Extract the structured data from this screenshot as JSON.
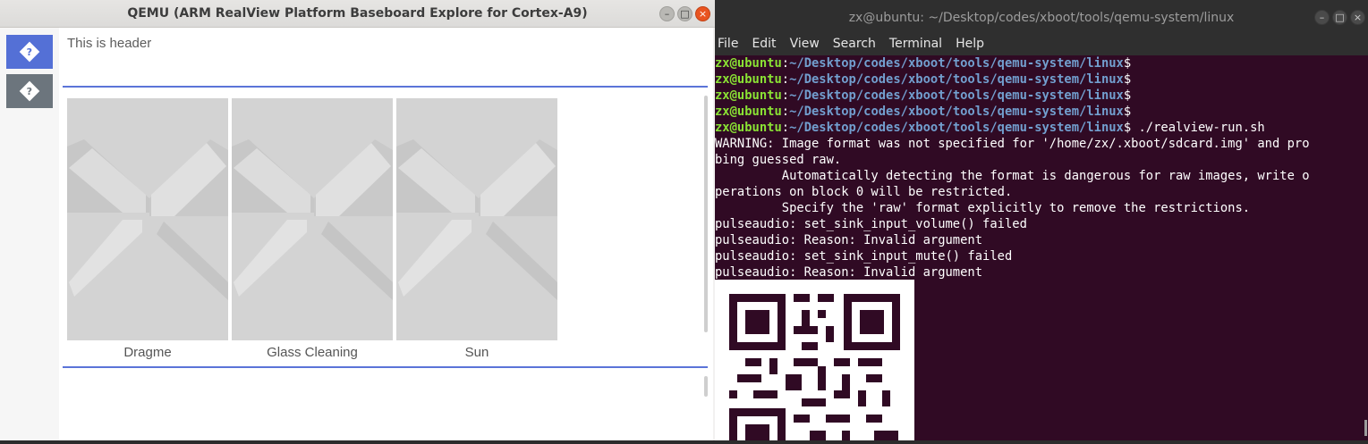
{
  "qemu": {
    "title": "QEMU (ARM RealView Platform Baseboard Explore for Cortex-A9)",
    "buttons": {
      "minimize": "–",
      "maximize": "□",
      "close": "×"
    },
    "sidebar": [
      {
        "glyph": "?",
        "color": "#5470d6"
      },
      {
        "glyph": "?",
        "color": "#6c757d"
      }
    ],
    "header": "This is header",
    "items": [
      {
        "label": "Dragme"
      },
      {
        "label": "Glass Cleaning"
      },
      {
        "label": "Sun"
      }
    ],
    "accent": "#5b74d8"
  },
  "terminal": {
    "title": "zx@ubuntu: ~/Desktop/codes/xboot/tools/qemu-system/linux",
    "buttons": {
      "minimize": "–",
      "maximize": "□",
      "close": "×"
    },
    "menu": [
      "File",
      "Edit",
      "View",
      "Search",
      "Terminal",
      "Help"
    ],
    "prompt": {
      "user": "zx@ubuntu",
      "path": "~/Desktop/codes/xboot/tools/qemu-system/linux",
      "sign": "$"
    },
    "commands": [
      "",
      "",
      "",
      "",
      " ./realview-run.sh"
    ],
    "output": [
      "WARNING: Image format was not specified for '/home/zx/.xboot/sdcard.img' and pro",
      "bing guessed raw.",
      "         Automatically detecting the format is dangerous for raw images, write o",
      "perations on block 0 will be restricted.",
      "         Specify the 'raw' format explicitly to remove the restrictions.",
      "pulseaudio: set_sink_input_volume() failed",
      "pulseaudio: Reason: Invalid argument",
      "pulseaudio: set_sink_input_mute() failed",
      "pulseaudio: Reason: Invalid argument"
    ],
    "colors": {
      "background": "#300a24",
      "user": "#8ae234",
      "path": "#729fcf"
    }
  }
}
